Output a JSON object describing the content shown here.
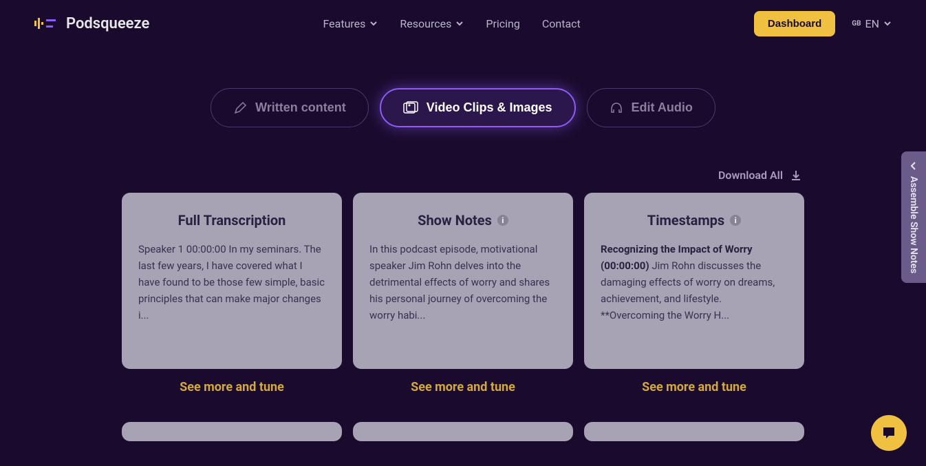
{
  "header": {
    "logo_text": "Podsqueeze",
    "nav": {
      "features": "Features",
      "resources": "Resources",
      "pricing": "Pricing",
      "contact": "Contact"
    },
    "dashboard_btn": "Dashboard",
    "lang_code": "GB",
    "lang_text": "EN"
  },
  "tabs": {
    "written": "Written content",
    "video": "Video Clips & Images",
    "audio": "Edit Audio"
  },
  "download_all": "Download All",
  "cards": [
    {
      "title": "Full Transcription",
      "body": "Speaker 1 00:00:00 In my seminars. The last few years, I have covered what I have found to be those few simple, basic principles that can make major changes i...",
      "see_more": "See more and tune",
      "has_info": false
    },
    {
      "title": "Show Notes",
      "body": "In this podcast episode, motivational speaker Jim Rohn delves into the detrimental effects of worry and shares his personal journey of overcoming the worry habi...",
      "see_more": "See more and tune",
      "has_info": true
    },
    {
      "title": "Timestamps",
      "body_bold": "Recognizing the Impact of Worry (00:00:00)",
      "body_rest": " Jim Rohn discusses the damaging effects of worry on dreams, achievement, and lifestyle. **Overcoming the Worry H...",
      "see_more": "See more and tune",
      "has_info": true
    }
  ],
  "side_tab": "Assemble Show Notes",
  "info_char": "i"
}
